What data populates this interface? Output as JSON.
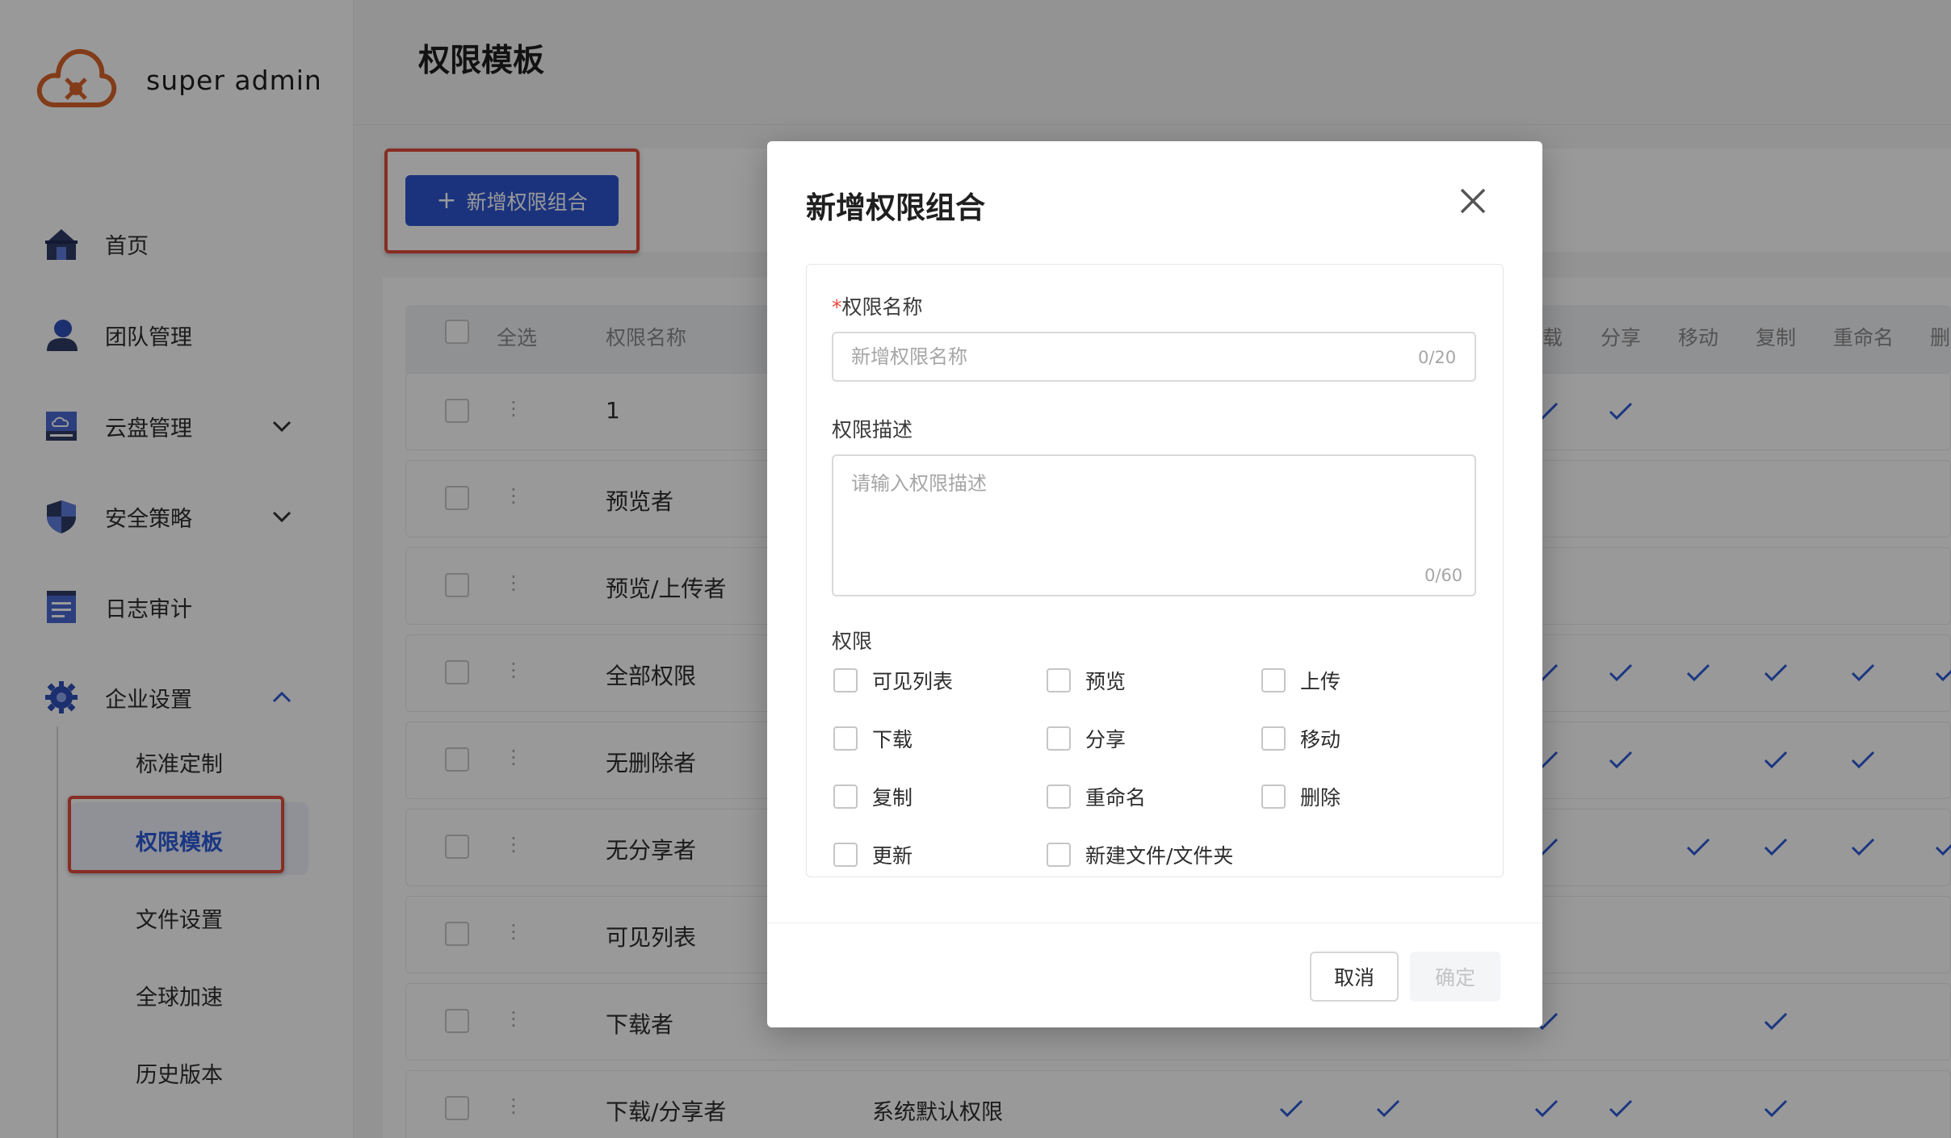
{
  "app": {
    "brand": "super admin"
  },
  "sidebar": {
    "items": [
      {
        "label": "首页",
        "icon": "home-icon"
      },
      {
        "label": "团队管理",
        "icon": "user-icon"
      },
      {
        "label": "云盘管理",
        "icon": "cloud-drive-icon",
        "expanded": false
      },
      {
        "label": "安全策略",
        "icon": "shield-icon",
        "expanded": false
      },
      {
        "label": "日志审计",
        "icon": "log-icon"
      },
      {
        "label": "企业设置",
        "icon": "gear-icon",
        "expanded": true
      }
    ],
    "sub_items": [
      {
        "label": "标准定制",
        "active": false
      },
      {
        "label": "权限模板",
        "active": true
      },
      {
        "label": "文件设置",
        "active": false
      },
      {
        "label": "全球加速",
        "active": false
      },
      {
        "label": "历史版本",
        "active": false
      }
    ]
  },
  "page": {
    "title": "权限模板",
    "add_button_label": "新增权限组合"
  },
  "table": {
    "headers": {
      "select_all": "全选",
      "name": "权限名称",
      "perm_cols": [
        "载",
        "分享",
        "移动",
        "复制",
        "重命名",
        "删"
      ]
    },
    "rows": [
      {
        "name": "1",
        "desc": ""
      },
      {
        "name": "预览者",
        "desc": ""
      },
      {
        "name": "预览/上传者",
        "desc": ""
      },
      {
        "name": "全部权限",
        "desc": ""
      },
      {
        "name": "无删除者",
        "desc": ""
      },
      {
        "name": "无分享者",
        "desc": ""
      },
      {
        "name": "可见列表",
        "desc": ""
      },
      {
        "name": "下载者",
        "desc": ""
      },
      {
        "name": "下载/分享者",
        "desc": "系统默认权限"
      }
    ]
  },
  "modal": {
    "title": "新增权限组合",
    "name_label": "权限名称",
    "name_required_mark": "*",
    "name_placeholder": "新增权限名称",
    "name_counter": "0/20",
    "desc_label": "权限描述",
    "desc_placeholder": "请输入权限描述",
    "desc_counter": "0/60",
    "perm_label": "权限",
    "permissions": [
      "可见列表",
      "预览",
      "上传",
      "下载",
      "分享",
      "移动",
      "复制",
      "重命名",
      "删除",
      "更新",
      "新建文件/文件夹"
    ],
    "cancel_label": "取消",
    "ok_label": "确定"
  },
  "colors": {
    "primary": "#2e56d0",
    "highlight": "#e34b3a",
    "logo": "#d9642a",
    "check": "#2d5ad7"
  }
}
